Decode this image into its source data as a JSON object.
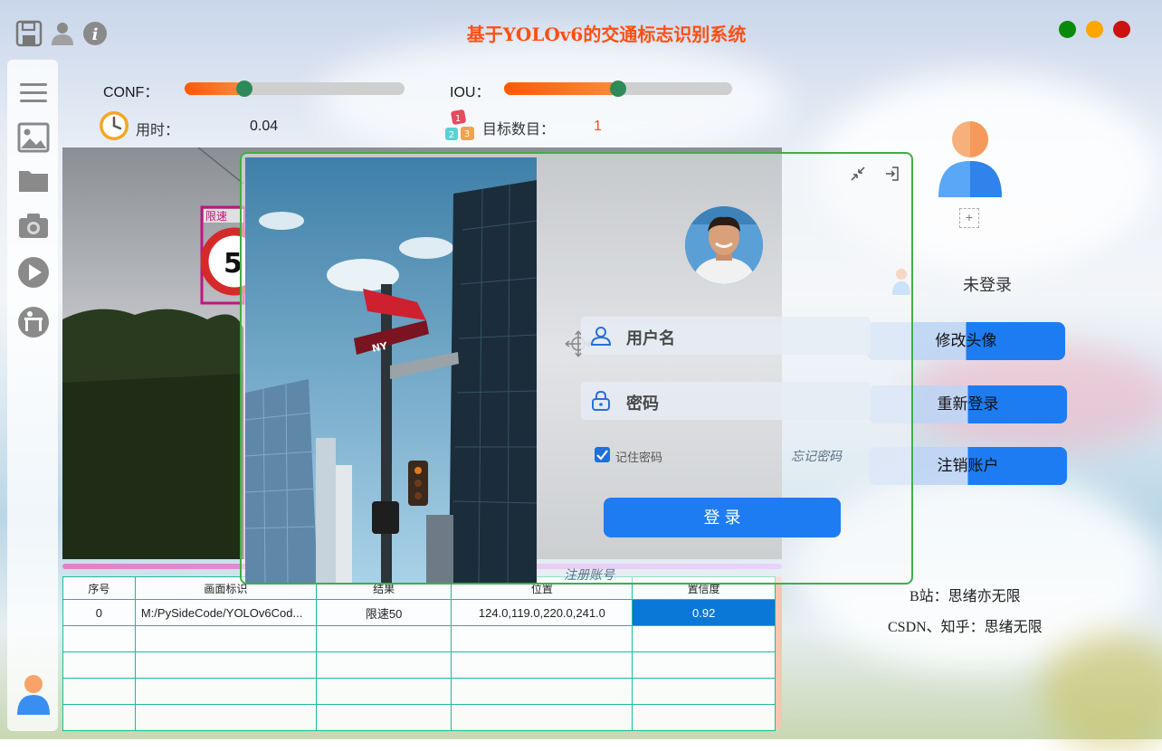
{
  "window": {
    "title": "基于YOLOv6的交通标志识别系统",
    "colors": {
      "title": "#ff4e13",
      "close": "#cc1111",
      "minimize": "#ffa500",
      "maximize": "#0a8a0a"
    },
    "top_icons": [
      "save-icon",
      "user-icon",
      "info-icon"
    ]
  },
  "sidebar": {
    "items": [
      "menu-icon",
      "image-icon",
      "folder-icon",
      "camera-icon",
      "play-icon",
      "desk-icon"
    ],
    "footer_icon": "user-avatar-icon"
  },
  "controls": {
    "conf_label": "CONF：",
    "conf_value": 0.27,
    "iou_label": "IOU：",
    "iou_value": 0.5,
    "time_label": "用时：",
    "time_value": "0.04",
    "count_label": "目标数目：",
    "count_value": "1"
  },
  "detection_box": {
    "label_top": "限速",
    "label_main": "5"
  },
  "table": {
    "headers": [
      "序号",
      "画面标识",
      "结果",
      "位置",
      "置信度"
    ],
    "rows": [
      [
        "0",
        "M:/PySideCode/YOLOv6Cod...",
        "限速50",
        "124.0,119.0,220.0,241.0",
        "0.92"
      ]
    ],
    "empty_rows": 4
  },
  "login": {
    "street_sign": "NY",
    "username_placeholder": "用户名",
    "password_placeholder": "密码",
    "remember_label": "记住密码",
    "remember_checked": true,
    "forgot_label": "忘记密码",
    "login_button": "登 录",
    "register_link": "注册账号"
  },
  "account": {
    "status": "未登录",
    "change_avatar": "修改头像",
    "relogin": "重新登录",
    "logout": "注销账户",
    "footer_bilibili": "B站：思绪亦无限",
    "footer_csdn": "CSDN、知乎：思绪无限"
  }
}
